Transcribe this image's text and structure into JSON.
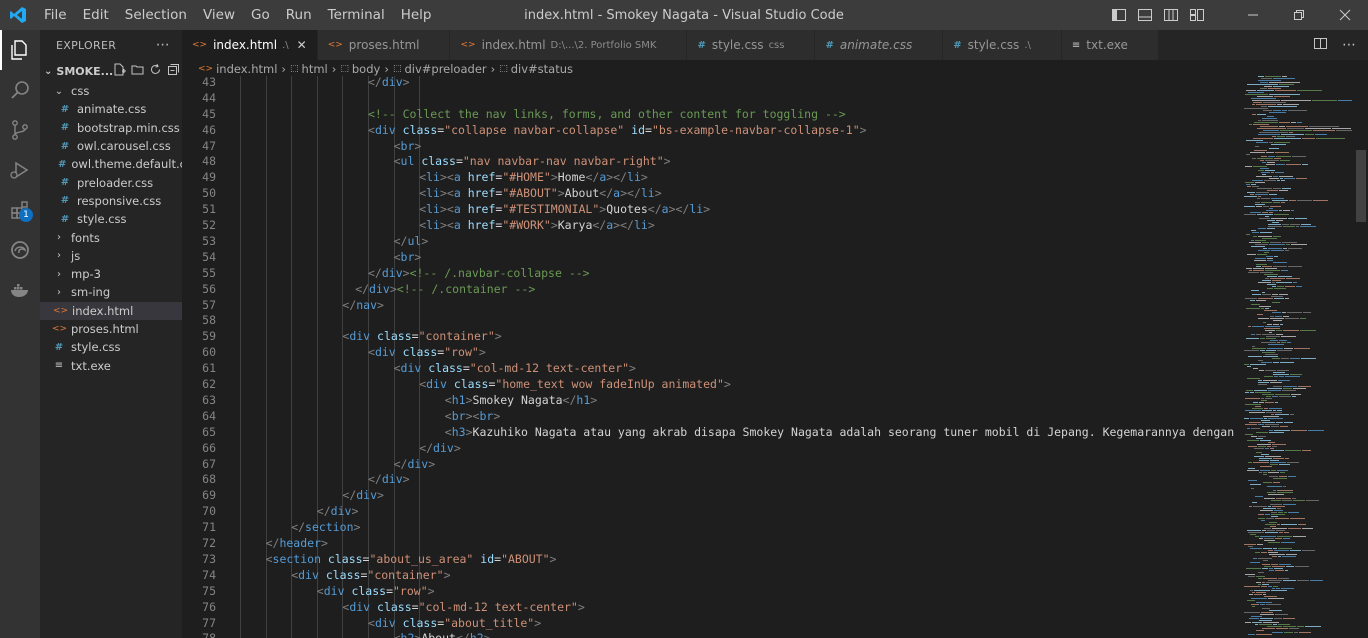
{
  "titlebar": {
    "menu": [
      "File",
      "Edit",
      "Selection",
      "View",
      "Go",
      "Run",
      "Terminal",
      "Help"
    ],
    "title": "index.html - Smokey Nagata - Visual Studio Code",
    "layout_icons": [
      "toggle-primary-sidebar-icon",
      "toggle-panel-icon",
      "toggle-secondary-sidebar-icon",
      "customize-layout-icon"
    ]
  },
  "activitybar": {
    "items": [
      "explorer-icon",
      "search-icon",
      "source-control-icon",
      "run-debug-icon",
      "extensions-icon",
      "edge-devtools-icon",
      "docker-icon"
    ],
    "extensions_badge": "1"
  },
  "sidebar": {
    "header": "EXPLORER",
    "folder": "SMOKE...",
    "items": [
      {
        "label": "css",
        "kind": "folder-open",
        "indent": 1
      },
      {
        "label": "animate.css",
        "kind": "css",
        "indent": 2
      },
      {
        "label": "bootstrap.min.css",
        "kind": "css",
        "indent": 2
      },
      {
        "label": "owl.carousel.css",
        "kind": "css",
        "indent": 2
      },
      {
        "label": "owl.theme.default.css",
        "kind": "css",
        "indent": 2
      },
      {
        "label": "preloader.css",
        "kind": "css",
        "indent": 2
      },
      {
        "label": "responsive.css",
        "kind": "css",
        "indent": 2
      },
      {
        "label": "style.css",
        "kind": "css",
        "indent": 2
      },
      {
        "label": "fonts",
        "kind": "folder",
        "indent": 1
      },
      {
        "label": "js",
        "kind": "folder",
        "indent": 1
      },
      {
        "label": "mp-3",
        "kind": "folder",
        "indent": 1
      },
      {
        "label": "sm-ing",
        "kind": "folder",
        "indent": 1
      },
      {
        "label": "index.html",
        "kind": "html",
        "indent": 1,
        "selected": true
      },
      {
        "label": "proses.html",
        "kind": "html",
        "indent": 1
      },
      {
        "label": "style.css",
        "kind": "css",
        "indent": 1
      },
      {
        "label": "txt.exe",
        "kind": "txt",
        "indent": 1
      }
    ]
  },
  "tabs": [
    {
      "label": "index.html",
      "desc": ".\\",
      "kind": "html",
      "active": true,
      "close": "✕"
    },
    {
      "label": "proses.html",
      "desc": "",
      "kind": "html"
    },
    {
      "label": "index.html",
      "desc": "D:\\...\\2. Portfolio SMK",
      "kind": "html"
    },
    {
      "label": "style.css",
      "desc": "css",
      "kind": "css"
    },
    {
      "label": "animate.css",
      "desc": "",
      "kind": "css",
      "italic": true
    },
    {
      "label": "style.css",
      "desc": ".\\",
      "kind": "css"
    },
    {
      "label": "txt.exe",
      "desc": "",
      "kind": "txt"
    }
  ],
  "breadcrumb": [
    "index.html",
    "html",
    "body",
    "div#preloader",
    "div#status"
  ],
  "editor": {
    "lines": [
      {
        "n": "43",
        "i": 5,
        "s": [
          [
            "t",
            "</"
          ],
          [
            "tn",
            "div"
          ],
          [
            "t",
            ">"
          ]
        ]
      },
      {
        "n": "44",
        "i": 0,
        "s": []
      },
      {
        "n": "45",
        "i": 5,
        "s": [
          [
            "cm",
            "<!-- Collect the nav links, forms, and other content for toggling -->"
          ]
        ]
      },
      {
        "n": "46",
        "i": 5,
        "s": [
          [
            "t",
            "<"
          ],
          [
            "tn",
            "div"
          ],
          [
            "at",
            " class"
          ],
          [
            "tx",
            "="
          ],
          [
            "st",
            "\"collapse navbar-collapse\""
          ],
          [
            "at",
            " id"
          ],
          [
            "tx",
            "="
          ],
          [
            "st",
            "\"bs-example-navbar-collapse-1\""
          ],
          [
            "t",
            ">"
          ]
        ]
      },
      {
        "n": "47",
        "i": 6,
        "s": [
          [
            "t",
            "<"
          ],
          [
            "tn",
            "br"
          ],
          [
            "t",
            ">"
          ]
        ]
      },
      {
        "n": "48",
        "i": 6,
        "s": [
          [
            "t",
            "<"
          ],
          [
            "tn",
            "ul"
          ],
          [
            "at",
            " class"
          ],
          [
            "tx",
            "="
          ],
          [
            "st",
            "\"nav navbar-nav navbar-right\""
          ],
          [
            "t",
            ">"
          ]
        ]
      },
      {
        "n": "49",
        "i": 7,
        "s": [
          [
            "t",
            "<"
          ],
          [
            "tn",
            "li"
          ],
          [
            "t",
            "><"
          ],
          [
            "tn",
            "a"
          ],
          [
            "at",
            " href"
          ],
          [
            "tx",
            "="
          ],
          [
            "st",
            "\"#HOME\""
          ],
          [
            "t",
            ">"
          ],
          [
            "tx",
            "Home"
          ],
          [
            "t",
            "</"
          ],
          [
            "tn",
            "a"
          ],
          [
            "t",
            "></"
          ],
          [
            "tn",
            "li"
          ],
          [
            "t",
            ">"
          ]
        ]
      },
      {
        "n": "50",
        "i": 7,
        "s": [
          [
            "t",
            "<"
          ],
          [
            "tn",
            "li"
          ],
          [
            "t",
            "><"
          ],
          [
            "tn",
            "a"
          ],
          [
            "at",
            " href"
          ],
          [
            "tx",
            "="
          ],
          [
            "st",
            "\"#ABOUT\""
          ],
          [
            "t",
            ">"
          ],
          [
            "tx",
            "About"
          ],
          [
            "t",
            "</"
          ],
          [
            "tn",
            "a"
          ],
          [
            "t",
            "></"
          ],
          [
            "tn",
            "li"
          ],
          [
            "t",
            ">"
          ]
        ]
      },
      {
        "n": "51",
        "i": 7,
        "s": [
          [
            "t",
            "<"
          ],
          [
            "tn",
            "li"
          ],
          [
            "t",
            "><"
          ],
          [
            "tn",
            "a"
          ],
          [
            "at",
            " href"
          ],
          [
            "tx",
            "="
          ],
          [
            "st",
            "\"#TESTIMONIAL\""
          ],
          [
            "t",
            ">"
          ],
          [
            "tx",
            "Quotes"
          ],
          [
            "t",
            "</"
          ],
          [
            "tn",
            "a"
          ],
          [
            "t",
            "></"
          ],
          [
            "tn",
            "li"
          ],
          [
            "t",
            ">"
          ]
        ]
      },
      {
        "n": "52",
        "i": 7,
        "s": [
          [
            "t",
            "<"
          ],
          [
            "tn",
            "li"
          ],
          [
            "t",
            "><"
          ],
          [
            "tn",
            "a"
          ],
          [
            "at",
            " href"
          ],
          [
            "tx",
            "="
          ],
          [
            "st",
            "\"#WORK\""
          ],
          [
            "t",
            ">"
          ],
          [
            "tx",
            "Karya"
          ],
          [
            "t",
            "</"
          ],
          [
            "tn",
            "a"
          ],
          [
            "t",
            "></"
          ],
          [
            "tn",
            "li"
          ],
          [
            "t",
            ">"
          ]
        ]
      },
      {
        "n": "53",
        "i": 6,
        "s": [
          [
            "t",
            "</"
          ],
          [
            "tn",
            "ul"
          ],
          [
            "t",
            ">"
          ]
        ]
      },
      {
        "n": "54",
        "i": 6,
        "s": [
          [
            "t",
            "<"
          ],
          [
            "tn",
            "br"
          ],
          [
            "t",
            ">"
          ]
        ]
      },
      {
        "n": "55",
        "i": 5,
        "s": [
          [
            "t",
            "</"
          ],
          [
            "tn",
            "div"
          ],
          [
            "t",
            ">"
          ],
          [
            "cm",
            "<!-- /.navbar-collapse -->"
          ]
        ]
      },
      {
        "n": "56",
        "i": 4.5,
        "s": [
          [
            "t",
            "</"
          ],
          [
            "tn",
            "div"
          ],
          [
            "t",
            ">"
          ],
          [
            "cm",
            "<!-- /.container -->"
          ]
        ]
      },
      {
        "n": "57",
        "i": 4,
        "s": [
          [
            "t",
            "</"
          ],
          [
            "tn",
            "nav"
          ],
          [
            "t",
            ">"
          ]
        ]
      },
      {
        "n": "58",
        "i": 0,
        "s": []
      },
      {
        "n": "59",
        "i": 4,
        "s": [
          [
            "t",
            "<"
          ],
          [
            "tn",
            "div"
          ],
          [
            "at",
            " class"
          ],
          [
            "tx",
            "="
          ],
          [
            "st",
            "\"container\""
          ],
          [
            "t",
            ">"
          ]
        ]
      },
      {
        "n": "60",
        "i": 5,
        "s": [
          [
            "t",
            "<"
          ],
          [
            "tn",
            "div"
          ],
          [
            "at",
            " class"
          ],
          [
            "tx",
            "="
          ],
          [
            "st",
            "\"row\""
          ],
          [
            "t",
            ">"
          ]
        ]
      },
      {
        "n": "61",
        "i": 6,
        "s": [
          [
            "t",
            "<"
          ],
          [
            "tn",
            "div"
          ],
          [
            "at",
            " class"
          ],
          [
            "tx",
            "="
          ],
          [
            "st",
            "\"col-md-12 text-center\""
          ],
          [
            "t",
            ">"
          ]
        ]
      },
      {
        "n": "62",
        "i": 7,
        "s": [
          [
            "t",
            "<"
          ],
          [
            "tn",
            "div"
          ],
          [
            "at",
            " class"
          ],
          [
            "tx",
            "="
          ],
          [
            "st",
            "\"home_text wow fadeInUp animated\""
          ],
          [
            "t",
            ">"
          ]
        ]
      },
      {
        "n": "63",
        "i": 8,
        "s": [
          [
            "t",
            "<"
          ],
          [
            "tn",
            "h1"
          ],
          [
            "t",
            ">"
          ],
          [
            "tx",
            "Smokey Nagata"
          ],
          [
            "t",
            "</"
          ],
          [
            "tn",
            "h1"
          ],
          [
            "t",
            ">"
          ]
        ]
      },
      {
        "n": "64",
        "i": 8,
        "s": [
          [
            "t",
            "<"
          ],
          [
            "tn",
            "br"
          ],
          [
            "t",
            "><"
          ],
          [
            "tn",
            "br"
          ],
          [
            "t",
            ">"
          ]
        ]
      },
      {
        "n": "65",
        "i": 8,
        "s": [
          [
            "t",
            "<"
          ],
          [
            "tn",
            "h3"
          ],
          [
            "t",
            ">"
          ],
          [
            "tx",
            "Kazuhiko Nagata atau yang akrab disapa Smokey Nagata adalah seorang tuner mobil di Jepang. Kegemarannya dengan mobil dir"
          ]
        ]
      },
      {
        "n": "66",
        "i": 7,
        "s": [
          [
            "t",
            "</"
          ],
          [
            "tn",
            "div"
          ],
          [
            "t",
            ">"
          ]
        ]
      },
      {
        "n": "67",
        "i": 6,
        "s": [
          [
            "t",
            "</"
          ],
          [
            "tn",
            "div"
          ],
          [
            "t",
            ">"
          ]
        ]
      },
      {
        "n": "68",
        "i": 5,
        "s": [
          [
            "t",
            "</"
          ],
          [
            "tn",
            "div"
          ],
          [
            "t",
            ">"
          ]
        ]
      },
      {
        "n": "69",
        "i": 4,
        "s": [
          [
            "t",
            "</"
          ],
          [
            "tn",
            "div"
          ],
          [
            "t",
            ">"
          ]
        ]
      },
      {
        "n": "70",
        "i": 3,
        "s": [
          [
            "t",
            "</"
          ],
          [
            "tn",
            "div"
          ],
          [
            "t",
            ">"
          ]
        ]
      },
      {
        "n": "71",
        "i": 2,
        "s": [
          [
            "t",
            "</"
          ],
          [
            "tn",
            "section"
          ],
          [
            "t",
            ">"
          ]
        ]
      },
      {
        "n": "72",
        "i": 1,
        "s": [
          [
            "t",
            "</"
          ],
          [
            "tn",
            "header"
          ],
          [
            "t",
            ">"
          ]
        ]
      },
      {
        "n": "73",
        "i": 1,
        "s": [
          [
            "t",
            "<"
          ],
          [
            "tn",
            "section"
          ],
          [
            "at",
            " class"
          ],
          [
            "tx",
            "="
          ],
          [
            "st",
            "\"about_us_area\""
          ],
          [
            "at",
            " id"
          ],
          [
            "tx",
            "="
          ],
          [
            "st",
            "\"ABOUT\""
          ],
          [
            "t",
            ">"
          ]
        ]
      },
      {
        "n": "74",
        "i": 2,
        "s": [
          [
            "t",
            "<"
          ],
          [
            "tn",
            "div"
          ],
          [
            "at",
            " class"
          ],
          [
            "tx",
            "="
          ],
          [
            "st",
            "\"container\""
          ],
          [
            "t",
            ">"
          ]
        ]
      },
      {
        "n": "75",
        "i": 3,
        "s": [
          [
            "t",
            "<"
          ],
          [
            "tn",
            "div"
          ],
          [
            "at",
            " class"
          ],
          [
            "tx",
            "="
          ],
          [
            "st",
            "\"row\""
          ],
          [
            "t",
            ">"
          ]
        ]
      },
      {
        "n": "76",
        "i": 4,
        "s": [
          [
            "t",
            "<"
          ],
          [
            "tn",
            "div"
          ],
          [
            "at",
            " class"
          ],
          [
            "tx",
            "="
          ],
          [
            "st",
            "\"col-md-12 text-center\""
          ],
          [
            "t",
            ">"
          ]
        ]
      },
      {
        "n": "77",
        "i": 5,
        "s": [
          [
            "t",
            "<"
          ],
          [
            "tn",
            "div"
          ],
          [
            "at",
            " class"
          ],
          [
            "tx",
            "="
          ],
          [
            "st",
            "\"about_title\""
          ],
          [
            "t",
            ">"
          ]
        ]
      },
      {
        "n": "78",
        "i": 6,
        "s": [
          [
            "t",
            "<"
          ],
          [
            "tn",
            "h2"
          ],
          [
            "t",
            ">"
          ],
          [
            "tx",
            "About"
          ],
          [
            "t",
            "</"
          ],
          [
            "tn",
            "h2"
          ],
          [
            "t",
            ">"
          ]
        ]
      }
    ]
  },
  "colors": {
    "tag_bracket": "#808080",
    "tag_name": "#569cd6",
    "attribute": "#9cdcfe",
    "string": "#ce9178",
    "comment": "#6a9955",
    "text": "#d4d4d4"
  }
}
